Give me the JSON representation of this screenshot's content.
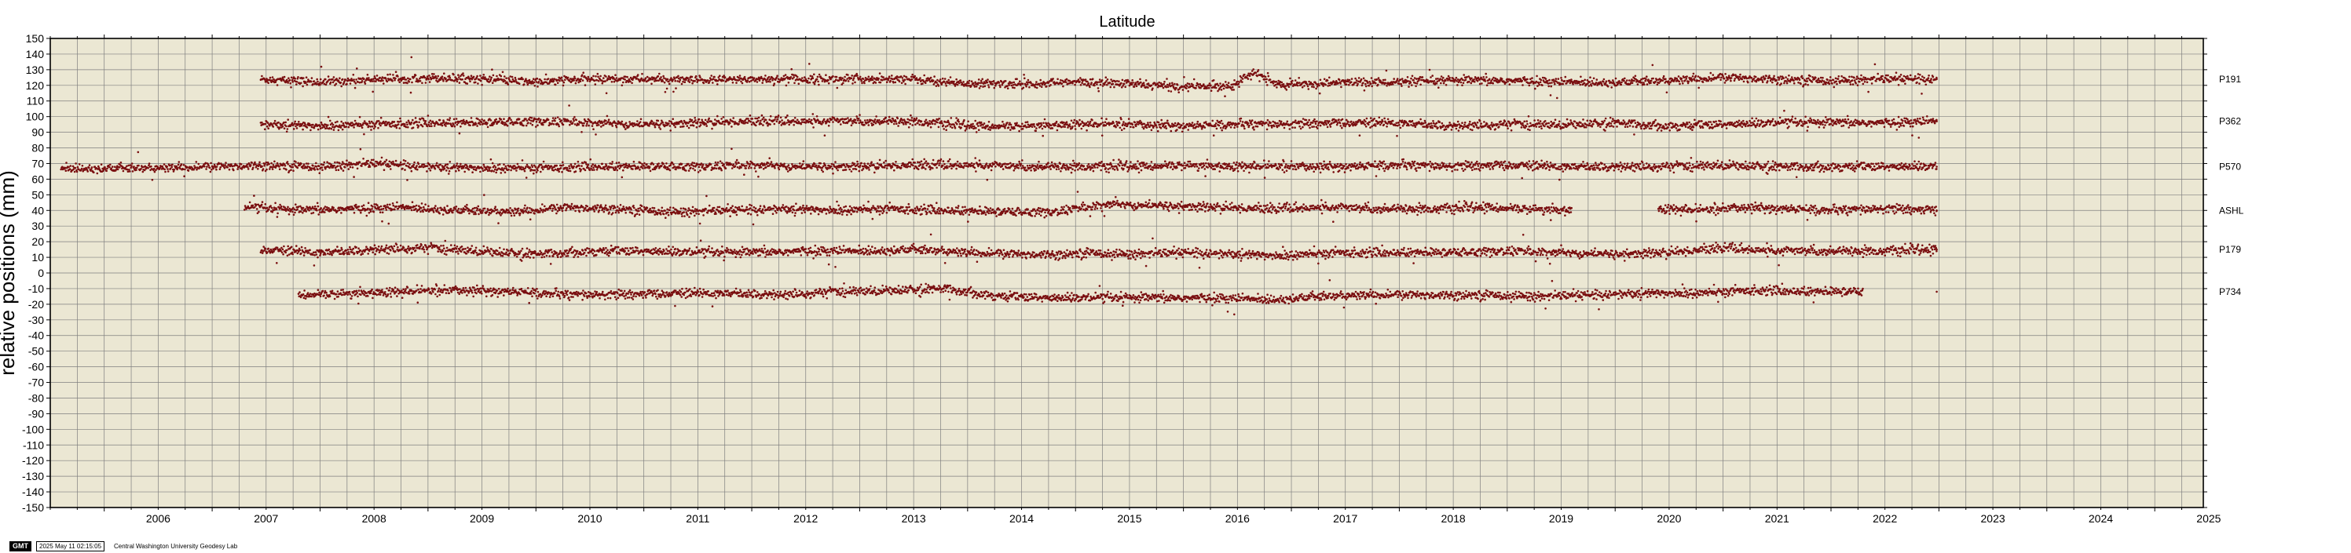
{
  "footer": {
    "logo": "GMT",
    "timestamp": "2025 May 11 02:15:05",
    "lab": "Central Washington University Geodesy Lab"
  },
  "colors": {
    "plot_background": "#ebe7d3",
    "grid": "#7f7f7f",
    "points": "#7a0f10",
    "frame": "#000000"
  },
  "chart_data": {
    "type": "scatter",
    "title": "Latitude",
    "xlabel": "",
    "ylabel": "relative positions (mm)",
    "xlim": [
      2005.5,
      2025.45
    ],
    "ylim": [
      -150,
      150
    ],
    "x_ticks": [
      2006,
      2007,
      2008,
      2009,
      2010,
      2011,
      2012,
      2013,
      2014,
      2015,
      2016,
      2017,
      2018,
      2019,
      2020,
      2021,
      2022,
      2023,
      2024,
      2025
    ],
    "y_ticks": [
      150,
      140,
      130,
      120,
      110,
      100,
      90,
      80,
      70,
      60,
      50,
      40,
      30,
      20,
      10,
      0,
      -10,
      -20,
      -30,
      -40,
      -50,
      -60,
      -70,
      -80,
      -90,
      -100,
      -110,
      -120,
      -130,
      -140,
      -150
    ],
    "grid": true,
    "legend": "station labels on right",
    "series": [
      {
        "name": "P191",
        "x": [
          2007.45,
          2008.0,
          2008.5,
          2009.0,
          2009.5,
          2010.0,
          2010.5,
          2011.0,
          2011.5,
          2012.0,
          2012.5,
          2013.0,
          2013.5,
          2014.0,
          2014.5,
          2015.0,
          2015.5,
          2016.0,
          2016.45,
          2016.65,
          2016.9,
          2017.5,
          2018.0,
          2018.5,
          2019.0,
          2019.5,
          2020.0,
          2020.5,
          2021.0,
          2021.5,
          2022.0,
          2022.5,
          2022.98
        ],
        "y": [
          124,
          122,
          124,
          125,
          124,
          122,
          124,
          124,
          123,
          124,
          124,
          124,
          124,
          121,
          121,
          122,
          121,
          119,
          120,
          128,
          120,
          122,
          122,
          123,
          123,
          122,
          122,
          123,
          125,
          124,
          123,
          124,
          124
        ]
      },
      {
        "name": "P362",
        "x": [
          2007.45,
          2008.0,
          2008.5,
          2009.0,
          2009.5,
          2010.0,
          2010.5,
          2011.0,
          2011.5,
          2012.0,
          2012.5,
          2013.0,
          2013.5,
          2014.0,
          2014.5,
          2015.0,
          2015.5,
          2016.0,
          2016.5,
          2017.0,
          2017.5,
          2018.0,
          2018.5,
          2019.0,
          2019.5,
          2020.0,
          2020.5,
          2021.0,
          2021.5,
          2022.0,
          2022.5,
          2022.98
        ],
        "y": [
          95,
          94,
          95,
          96,
          96,
          97,
          96,
          95,
          96,
          97,
          97,
          97,
          97,
          94,
          94,
          95,
          95,
          94,
          95,
          95,
          96,
          96,
          94,
          95,
          95,
          96,
          94,
          95,
          96,
          96,
          96,
          97
        ]
      },
      {
        "name": "P570",
        "x": [
          2005.6,
          2006.0,
          2006.5,
          2007.0,
          2007.5,
          2008.0,
          2008.5,
          2009.0,
          2009.5,
          2010.0,
          2010.5,
          2011.0,
          2011.5,
          2012.0,
          2012.5,
          2013.0,
          2013.5,
          2014.0,
          2014.5,
          2015.0,
          2015.5,
          2016.0,
          2016.5,
          2017.0,
          2017.5,
          2018.0,
          2018.5,
          2019.0,
          2019.5,
          2020.0,
          2020.5,
          2021.0,
          2021.5,
          2022.0,
          2022.5,
          2022.98
        ],
        "y": [
          67,
          67,
          67,
          68,
          69,
          68,
          70,
          68,
          67,
          67,
          68,
          68,
          68,
          69,
          68,
          68,
          69,
          69,
          68,
          68,
          68,
          69,
          68,
          68,
          68,
          69,
          68,
          69,
          68,
          68,
          68,
          69,
          68,
          68,
          68,
          68
        ]
      },
      {
        "name": "ASHL",
        "x": [
          2007.3,
          2007.8,
          2008.3,
          2008.8,
          2009.3,
          2009.8,
          2010.3,
          2010.8,
          2011.3,
          2011.8,
          2012.3,
          2012.8,
          2013.3,
          2013.8,
          2014.3,
          2014.8,
          2015.3,
          2015.8,
          2016.3,
          2016.8,
          2017.3,
          2017.8,
          2018.35,
          2018.8,
          2019.2,
          2019.6,
          2020.4,
          2020.8,
          2021.2,
          2021.6,
          2022.0,
          2022.5,
          2022.98
        ],
        "y": [
          42,
          40,
          41,
          42,
          40,
          39,
          42,
          41,
          39,
          40,
          41,
          40,
          41,
          40,
          39,
          39,
          44,
          43,
          42,
          41,
          42,
          41,
          41,
          42,
          41,
          40,
          41,
          40,
          42,
          41,
          40,
          41,
          40
        ]
      },
      {
        "name": "P179",
        "x": [
          2007.45,
          2008.0,
          2008.5,
          2009.0,
          2009.5,
          2010.0,
          2010.5,
          2011.0,
          2011.5,
          2012.0,
          2012.5,
          2013.0,
          2013.5,
          2014.0,
          2014.5,
          2014.9,
          2015.1,
          2015.5,
          2016.0,
          2016.5,
          2016.9,
          2017.2,
          2017.5,
          2018.0,
          2018.5,
          2019.0,
          2019.5,
          2020.0,
          2020.5,
          2021.0,
          2021.5,
          2022.0,
          2022.5,
          2022.98
        ],
        "y": [
          15,
          13,
          15,
          16,
          14,
          12,
          14,
          14,
          13,
          13,
          14,
          14,
          15,
          13,
          12,
          12,
          13,
          12,
          13,
          12,
          11,
          12,
          13,
          13,
          13,
          14,
          13,
          12,
          13,
          16,
          14,
          14,
          14,
          15
        ]
      },
      {
        "name": "P734",
        "x": [
          2007.8,
          2008.3,
          2008.8,
          2009.3,
          2009.8,
          2010.3,
          2010.8,
          2011.3,
          2011.8,
          2012.3,
          2012.8,
          2013.3,
          2013.8,
          2014.3,
          2014.8,
          2015.3,
          2015.8,
          2016.3,
          2016.8,
          2017.3,
          2017.8,
          2018.3,
          2018.8,
          2019.3,
          2019.8,
          2020.3,
          2020.8,
          2021.3,
          2021.8,
          2022.3,
          2022.98
        ],
        "y": [
          -14,
          -13,
          -12,
          -11,
          -12,
          -14,
          -14,
          -13,
          -13,
          -14,
          -12,
          -11,
          -10,
          -15,
          -16,
          -16,
          -16,
          -16,
          -17,
          -15,
          -14,
          -14,
          -14,
          -15,
          -14,
          -13,
          -13,
          -11,
          -12,
          -12,
          -12
        ]
      }
    ]
  }
}
